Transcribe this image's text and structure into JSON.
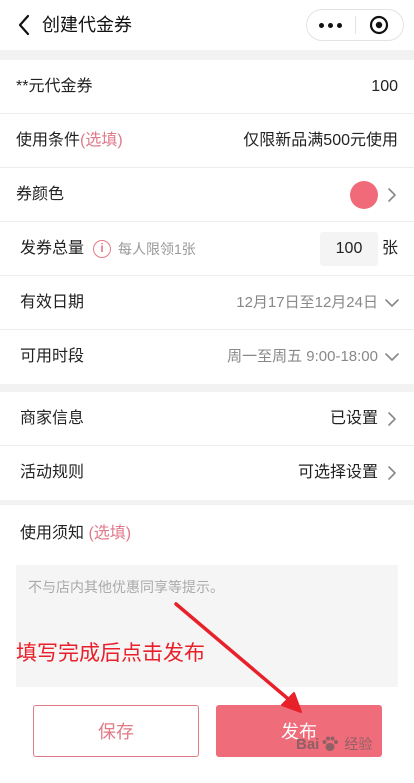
{
  "nav": {
    "title": "创建代金券"
  },
  "voucher": {
    "label": "**元代金券",
    "value": "100"
  },
  "condition": {
    "label": "使用条件",
    "optional": "(选填)",
    "value": "仅限新品满500元使用"
  },
  "color": {
    "label": "券颜色",
    "swatch": "#f06a7a"
  },
  "total": {
    "label": "发券总量",
    "hint": "每人限领1张",
    "quantity": "100",
    "unit": "张"
  },
  "validity": {
    "label": "有效日期",
    "value": "12月17日至12月24日"
  },
  "period": {
    "label": "可用时段",
    "value": "周一至周五 9:00-18:00"
  },
  "merchant": {
    "label": "商家信息",
    "value": "已设置"
  },
  "rules": {
    "label": "活动规则",
    "value": "可选择设置"
  },
  "notice": {
    "label": "使用须知",
    "optional": "(选填)",
    "placeholder": "不与店内其他优惠同享等提示。"
  },
  "annotation": "填写完成后点击发布",
  "footer": {
    "save_label": "保存",
    "publish_label": "发布"
  },
  "watermark": {
    "brand_a": "Bai",
    "brand_b": "经验"
  },
  "colors": {
    "accent": "#ef6c7a",
    "annotation": "#e8202a"
  }
}
